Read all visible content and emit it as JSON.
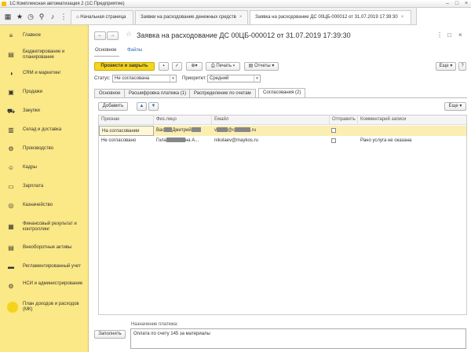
{
  "window": {
    "title": "1С:Комплексная автоматизация 2 (1С:Предприятие)"
  },
  "tabs": [
    {
      "label": "Начальная страница"
    },
    {
      "label": "Заявки на расходование денежных средств"
    },
    {
      "label": "Заявка на расходование ДС 00ЦБ-000012 от 31.07.2019 17:39:30"
    }
  ],
  "sidebar": {
    "items": [
      {
        "label": "Главное",
        "icon": "menu-icon"
      },
      {
        "label": "Бюджетирование и планирование",
        "icon": "budget-icon"
      },
      {
        "label": "CRM и маркетинг",
        "icon": "crm-icon"
      },
      {
        "label": "Продажи",
        "icon": "sales-icon"
      },
      {
        "label": "Закупки",
        "icon": "purchases-icon"
      },
      {
        "label": "Склад и доставка",
        "icon": "warehouse-icon"
      },
      {
        "label": "Производство",
        "icon": "production-icon"
      },
      {
        "label": "Кадры",
        "icon": "personnel-icon"
      },
      {
        "label": "Зарплата",
        "icon": "salary-icon"
      },
      {
        "label": "Казначейство",
        "icon": "treasury-icon"
      },
      {
        "label": "Финансовый результат и контроллинг",
        "icon": "finance-icon"
      },
      {
        "label": "Внеоборотные активы",
        "icon": "assets-icon"
      },
      {
        "label": "Регламентированный учет",
        "icon": "accounting-icon"
      },
      {
        "label": "НСИ и администрирование",
        "icon": "settings-icon"
      },
      {
        "label": "План доходов и расходов (МК)",
        "icon": "plan-icon"
      }
    ]
  },
  "doc": {
    "title": "Заявка на расходование ДС 00ЦБ-000012 от 31.07.2019 17:39:30",
    "subtabs": [
      "Основное",
      "Файлы"
    ],
    "actions": {
      "post_close": "Провести и закрыть",
      "print": "Печать",
      "reports": "Отчеты",
      "more": "Еще"
    },
    "status_label": "Статус:",
    "status_value": "Не согласована",
    "priority_label": "Приоритет:",
    "priority_value": "Средний",
    "form_tabs": [
      "Основное",
      "Расшифровка платежа (1)",
      "Распределение по счетам",
      "Согласования (2)"
    ],
    "add_button": "Добавить",
    "grid_more": "Еще",
    "columns": [
      "Признак",
      "Физ.лицо",
      "Емайл",
      "Отправить",
      "Комментарий записи"
    ],
    "rows": [
      {
        "status": "На согласовании",
        "person_a": "Вас",
        "person_b": "Дмитрий",
        "email_a": "v",
        "email_b": "@c",
        "email_c": ".ru",
        "comment": ""
      },
      {
        "status": "Не согласовано",
        "person_a": "Гола",
        "person_b": "на А...",
        "email_a": "nikolaev@maykos.ru",
        "email_b": "",
        "email_c": "",
        "comment": "Рано услуга не оказана"
      }
    ],
    "payment_label": "Назначение платежа:",
    "payment_value": "Оплата по счету 145 за материалы",
    "fill_button": "Заполнить"
  },
  "colors": {
    "sidebar": "#fbe886",
    "primary": "#f5d51f",
    "selected_row": "#fbeeb3"
  }
}
